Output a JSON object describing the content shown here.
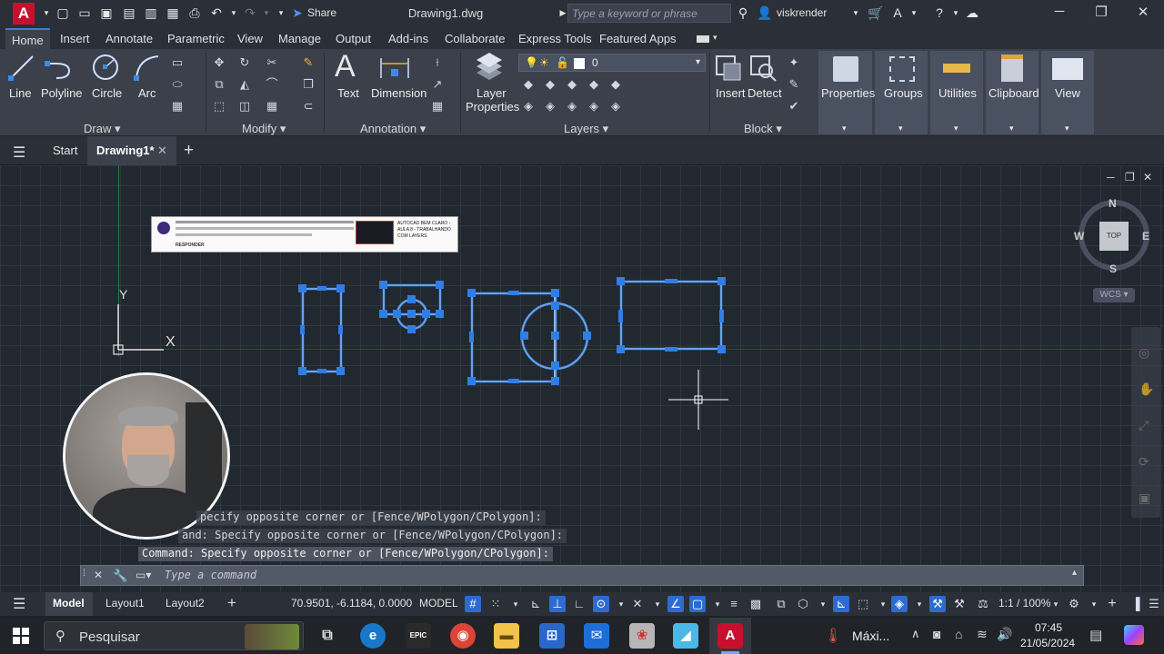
{
  "titlebar": {
    "app_logo": "A",
    "share_label": "Share",
    "title": "Drawing1.dwg",
    "search_placeholder": "Type a keyword or phrase",
    "username": "viskrender"
  },
  "menu_tabs": [
    "Home",
    "Insert",
    "Annotate",
    "Parametric",
    "View",
    "Manage",
    "Output",
    "Add-ins",
    "Collaborate",
    "Express Tools",
    "Featured Apps"
  ],
  "ribbon": {
    "draw_tools": [
      "Line",
      "Polyline",
      "Circle",
      "Arc"
    ],
    "annotation_tools": [
      "Text",
      "Dimension"
    ],
    "layer_properties": [
      "Layer",
      "Properties"
    ],
    "layer_current": "0",
    "block_tools": [
      "Insert",
      "Detect"
    ],
    "right_tools": [
      "Properties",
      "Groups",
      "Utilities",
      "Clipboard",
      "View"
    ],
    "panels": {
      "draw": "Draw",
      "modify": "Modify",
      "annotation": "Annotation",
      "layers": "Layers",
      "block": "Block"
    }
  },
  "file_tabs": {
    "start": "Start",
    "drawing": "Drawing1*"
  },
  "viewcube": {
    "n": "N",
    "s": "S",
    "e": "E",
    "w": "W",
    "top": "TOP",
    "wcs": "WCS"
  },
  "ucs": {
    "x": "X",
    "y": "Y"
  },
  "command_history": [
    "Specify opposite corner or [Fence/WPolygon/CPolygon]:",
    "Command: Specify opposite corner or [Fence/WPolygon/CPolygon]:",
    "Command: Specify opposite corner or [Fence/WPolygon/CPolygon]:"
  ],
  "command_visible": [
    "pecify opposite corner or [Fence/WPolygon/CPolygon]:",
    "and: Specify opposite corner or [Fence/WPolygon/CPolygon]:",
    "Command: Specify opposite corner or [Fence/WPolygon/CPolygon]:"
  ],
  "command_placeholder": "Type a command",
  "status": {
    "model_tab": "Model",
    "layout1": "Layout1",
    "layout2": "Layout2",
    "coordinates": "70.9501, -6.1184, 0.0000",
    "space": "MODEL",
    "scale": "1:1 / 100%"
  },
  "comment_overlay": {
    "text_line1": "Que tal fazer comentário aqui?",
    "responder": "RESPONDER",
    "thumb_title": "AUTOCAD BEM CLARO - AULA 8 - TRABALHANDO COM LAYERS"
  },
  "taskbar": {
    "search_label": "Pesquisar",
    "weather": "Máxi...",
    "time": "07:45",
    "date": "21/05/2024"
  },
  "colors": {
    "selection_blue": "#2f7ee6",
    "grip_blue": "#2f7ee6",
    "accent": "#3e7bd6"
  }
}
